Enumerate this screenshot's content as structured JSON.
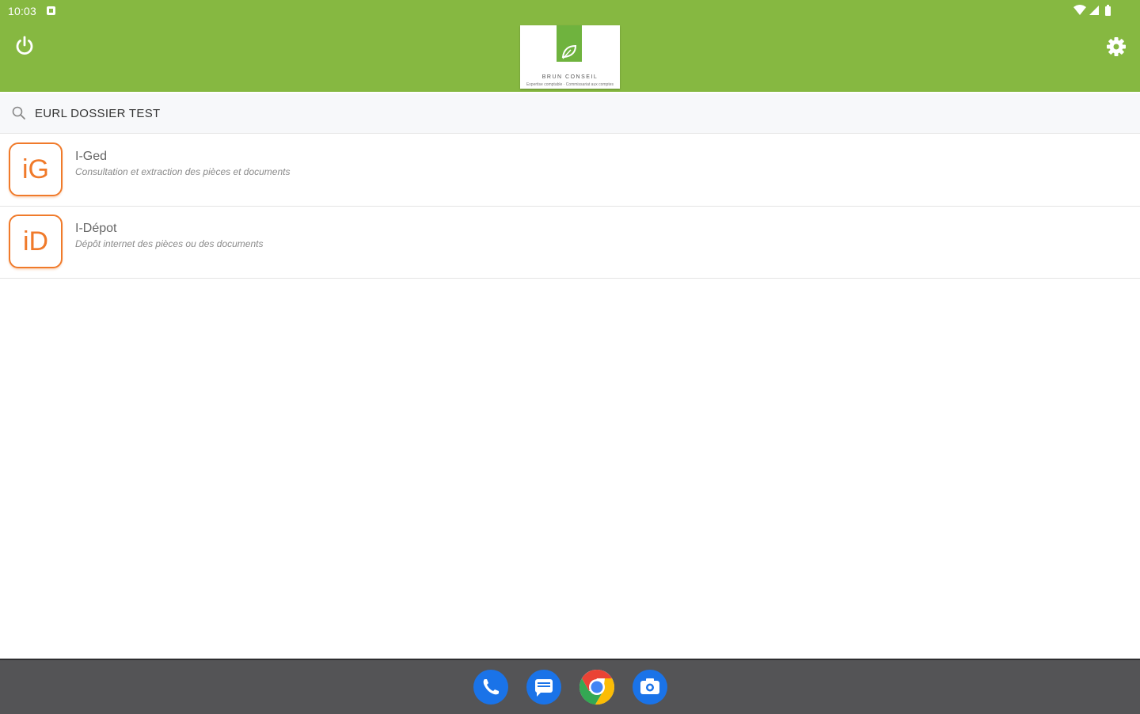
{
  "status_bar": {
    "time": "10:03"
  },
  "header": {
    "power_icon": "power-icon",
    "settings_icon": "gear-icon",
    "logo_text": "BRUN CONSEIL",
    "logo_subtext": "Expertise comptable · Commissariat aux comptes",
    "background_color": "#86b841"
  },
  "search": {
    "value": "EURL DOSSIER TEST"
  },
  "apps": [
    {
      "icon_text": "iG",
      "title": "I-Ged",
      "description": "Consultation et extraction des pièces et documents"
    },
    {
      "icon_text": "iD",
      "title": "I-Dépot",
      "description": "Dépôt internet des pièces ou des documents"
    }
  ],
  "accent_color": "#f07a2a",
  "dock": {
    "apps": [
      "phone-icon",
      "messages-icon",
      "chrome-icon",
      "camera-icon"
    ]
  }
}
